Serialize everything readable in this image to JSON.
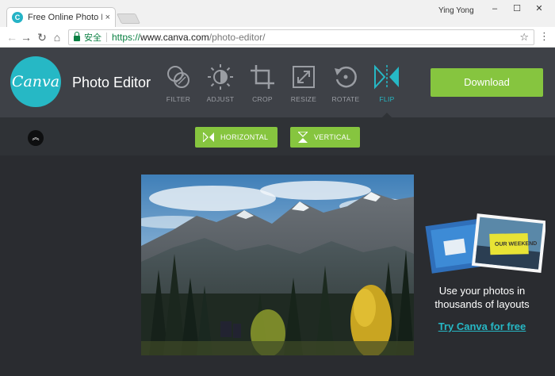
{
  "browser": {
    "tab_title": "Free Online Photo Edito",
    "tab_close": "×",
    "favicon_letter": "C",
    "user_name": "Ying Yong",
    "window_buttons": [
      "–",
      "☐",
      "✕"
    ],
    "secure_label": "安全",
    "url_scheme": "https://",
    "url_host": "www.canva.com",
    "url_path": "/photo-editor/"
  },
  "app": {
    "logo_text": "Canva",
    "title": "Photo Editor",
    "tools": [
      {
        "label": "FILTER",
        "icon": "filter-icon"
      },
      {
        "label": "ADJUST",
        "icon": "adjust-icon"
      },
      {
        "label": "CROP",
        "icon": "crop-icon"
      },
      {
        "label": "RESIZE",
        "icon": "resize-icon"
      },
      {
        "label": "ROTATE",
        "icon": "rotate-icon"
      },
      {
        "label": "FLIP",
        "icon": "flip-icon",
        "active": true
      }
    ],
    "download_label": "Download",
    "accent_color": "#26b8c5",
    "button_color": "#86c53f"
  },
  "subbar": {
    "horizontal_label": "HORIZONTAL",
    "vertical_label": "VERTICAL"
  },
  "promo": {
    "card_text": "OUR WEEKEND",
    "text": "Use your photos in thousands of layouts",
    "link": "Try Canva for free"
  }
}
